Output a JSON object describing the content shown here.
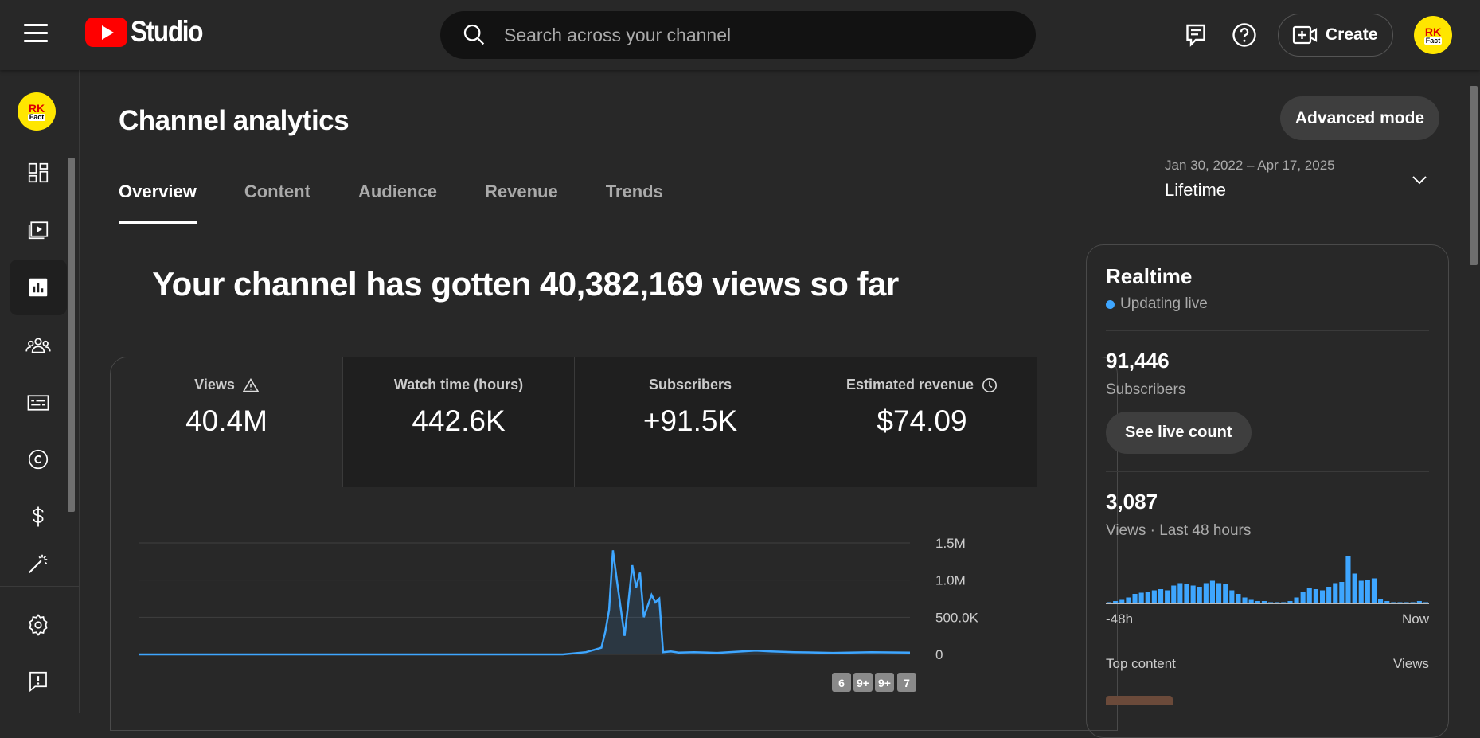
{
  "header": {
    "logo_text": "Studio",
    "search_placeholder": "Search across your channel",
    "create_label": "Create",
    "avatar": {
      "line1": "RK",
      "line2": "Fact"
    }
  },
  "sidebar": {
    "avatar": {
      "line1": "RK",
      "line2": "Fact"
    },
    "items": [
      {
        "icon": "dashboard-icon"
      },
      {
        "icon": "content-icon"
      },
      {
        "icon": "analytics-icon",
        "active": true
      },
      {
        "icon": "community-icon"
      },
      {
        "icon": "subtitles-icon"
      },
      {
        "icon": "copyright-icon"
      },
      {
        "icon": "earn-icon"
      },
      {
        "icon": "customization-icon"
      },
      {
        "icon": "settings-icon"
      },
      {
        "icon": "feedback-icon"
      }
    ]
  },
  "page": {
    "title": "Channel analytics",
    "advanced_mode_label": "Advanced mode",
    "tabs": [
      "Overview",
      "Content",
      "Audience",
      "Revenue",
      "Trends"
    ],
    "active_tab": "Overview",
    "date_range": {
      "dates": "Jan 30, 2022 – Apr 17, 2025",
      "period": "Lifetime"
    },
    "headline": "Your channel has gotten 40,382,169 views so far"
  },
  "metrics": [
    {
      "label": "Views",
      "value": "40.4M",
      "icon": "warning-icon"
    },
    {
      "label": "Watch time (hours)",
      "value": "442.6K"
    },
    {
      "label": "Subscribers",
      "value": "+91.5K"
    },
    {
      "label": "Estimated revenue",
      "value": "$74.09",
      "icon": "clock-icon"
    }
  ],
  "chart_data": [
    {
      "type": "line",
      "series_color": "#3ea6ff",
      "ylim": [
        0,
        1500000
      ],
      "y_ticks": [
        "1.5M",
        "1.0M",
        "500.0K",
        "0"
      ],
      "y_tick_values": [
        1500000,
        1000000,
        500000,
        0
      ],
      "x_range": [
        0,
        1
      ],
      "x": [
        0,
        0.2,
        0.4,
        0.55,
        0.58,
        0.59,
        0.6,
        0.605,
        0.61,
        0.615,
        0.62,
        0.63,
        0.635,
        0.64,
        0.645,
        0.65,
        0.655,
        0.66,
        0.665,
        0.67,
        0.675,
        0.68,
        0.69,
        0.7,
        0.72,
        0.75,
        0.8,
        0.82,
        0.85,
        0.9,
        0.95,
        1.0
      ],
      "values": [
        0,
        0,
        0,
        0,
        30000,
        60000,
        90000,
        300000,
        600000,
        1400000,
        1000000,
        250000,
        700000,
        1200000,
        900000,
        1100000,
        500000,
        650000,
        800000,
        700000,
        750000,
        30000,
        40000,
        25000,
        30000,
        20000,
        50000,
        40000,
        30000,
        20000,
        30000,
        25000
      ],
      "annotations": [
        "6",
        "9+",
        "9+",
        "7"
      ]
    },
    {
      "type": "bar",
      "title": "Views · Last 48 hours",
      "x_labels": [
        "-48h",
        "Now"
      ],
      "color": "#3ea6ff",
      "values": [
        1,
        2,
        3,
        5,
        8,
        9,
        10,
        11,
        12,
        11,
        15,
        17,
        16,
        15,
        14,
        17,
        19,
        17,
        16,
        11,
        8,
        5,
        3,
        2,
        2,
        1,
        1,
        1,
        2,
        5,
        10,
        13,
        12,
        11,
        14,
        17,
        18,
        40,
        25,
        19,
        20,
        21,
        4,
        2,
        1,
        1,
        1,
        1,
        2,
        1
      ]
    }
  ],
  "realtime": {
    "title": "Realtime",
    "live_label": "Updating live",
    "subscribers_value": "91,446",
    "subscribers_label": "Subscribers",
    "see_live_label": "See live count",
    "views_value": "3,087",
    "views_label": "Views · Last 48 hours",
    "axis_start": "-48h",
    "axis_end": "Now",
    "top_content_label": "Top content",
    "top_content_col": "Views"
  }
}
